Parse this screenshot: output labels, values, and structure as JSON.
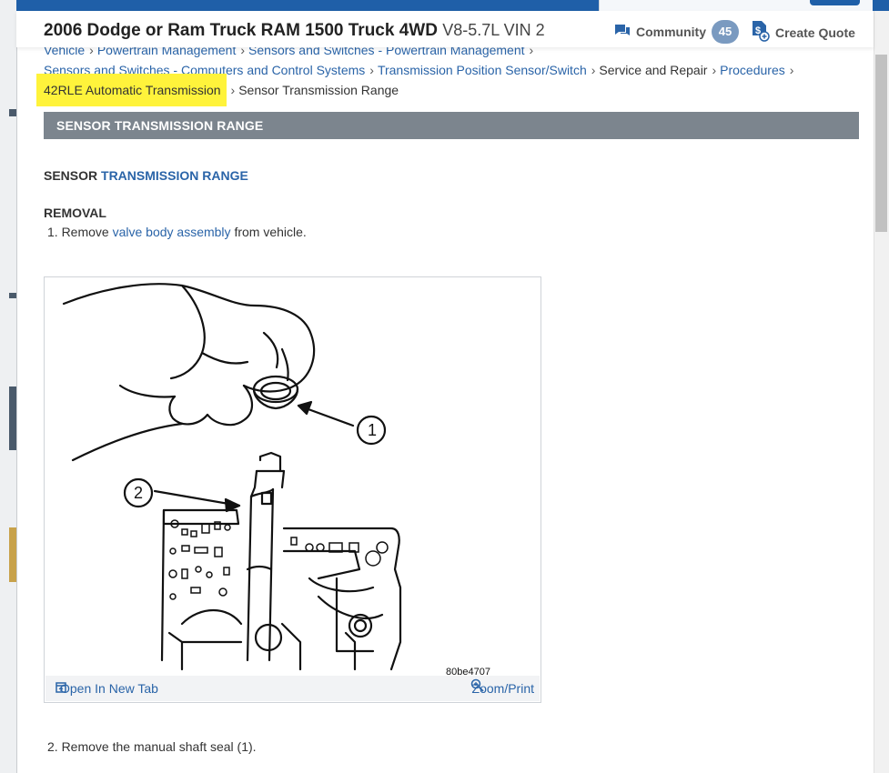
{
  "header": {
    "title": "2006 Dodge or Ram Truck RAM 1500 Truck 4WD",
    "engine": "V8-5.7L VIN 2",
    "community_label": "Community",
    "community_count": "45",
    "create_quote_label": "Create Quote"
  },
  "breadcrumb": {
    "row1": [
      "Vehicle",
      "Powertrain Management",
      "Sensors and Switches - Powertrain Management"
    ],
    "row2": [
      "Sensors and Switches - Computers and Control Systems",
      "Transmission Position Sensor/Switch",
      "Service and Repair",
      "Procedures"
    ],
    "row3_highlight": "42RLE Automatic Transmission",
    "current": "Sensor Transmission Range"
  },
  "section_title": "SENSOR TRANSMISSION RANGE",
  "doc": {
    "heading_prefix": "SENSOR",
    "heading_link": "TRANSMISSION RANGE",
    "removal_label": "REMOVAL",
    "step1_prefix": "1. Remove",
    "step1_link": "valve body assembly",
    "step1_suffix": "from vehicle.",
    "step2": "2. Remove the manual shaft seal (1)."
  },
  "figure": {
    "callout_1": "1",
    "callout_2": "2",
    "figure_code": "80be4707",
    "open_new_tab": "Open In New Tab",
    "zoom_print": "Zoom/Print"
  },
  "colors": {
    "link": "#2a64a8",
    "highlight": "#fff33b",
    "section_bar": "#7c858e",
    "brand_blue": "#1f5fa8",
    "badge": "#7a9ac0"
  },
  "icons": {
    "community": "chat-bubbles-icon",
    "quote": "dollar-document-icon",
    "open_tab": "open-new-tab-icon",
    "zoom": "zoom-in-icon",
    "breadcrumb_separator": "chevron-right-icon"
  }
}
